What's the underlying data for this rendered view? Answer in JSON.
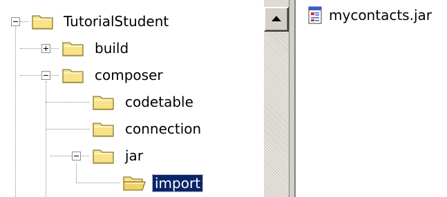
{
  "tree": {
    "nodes": [
      {
        "label": "TutorialStudent",
        "expander": "minus",
        "icon": "folder-closed-icon"
      },
      {
        "label": "build",
        "expander": "plus",
        "icon": "folder-closed-icon"
      },
      {
        "label": "composer",
        "expander": "minus",
        "icon": "folder-closed-icon"
      },
      {
        "label": "codetable",
        "expander": "",
        "icon": "folder-closed-icon"
      },
      {
        "label": "connection",
        "expander": "",
        "icon": "folder-closed-icon"
      },
      {
        "label": "jar",
        "expander": "minus",
        "icon": "folder-closed-icon"
      },
      {
        "label": "import",
        "expander": "",
        "icon": "folder-open-icon",
        "selected": true
      }
    ]
  },
  "files": [
    {
      "name": "mycontacts.jar",
      "icon": "jar-file-icon"
    }
  ],
  "colors": {
    "selection_bg": "#0a246a",
    "selection_fg": "#ffffff",
    "folder_fill": "#f8e38a",
    "folder_stroke": "#8a7a2a",
    "chrome": "#d4d0c8"
  }
}
